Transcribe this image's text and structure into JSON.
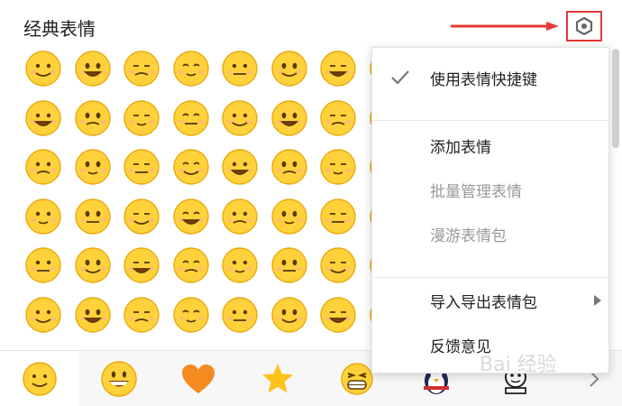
{
  "panel": {
    "title": "经典表情"
  },
  "settings": {
    "icon": "gear-icon",
    "highlight_color": "#e53935"
  },
  "menu": {
    "items": [
      {
        "label": "使用表情快捷键",
        "checked": true,
        "enabled": true,
        "submenu": false
      },
      {
        "label": "添加表情",
        "checked": false,
        "enabled": true,
        "submenu": false
      },
      {
        "label": "批量管理表情",
        "checked": false,
        "enabled": false,
        "submenu": false
      },
      {
        "label": "漫游表情包",
        "checked": false,
        "enabled": false,
        "submenu": false
      },
      {
        "label": "导入导出表情包",
        "checked": false,
        "enabled": true,
        "submenu": true
      },
      {
        "label": "反馈意见",
        "checked": false,
        "enabled": true,
        "submenu": false
      }
    ]
  },
  "emoji_grid": {
    "rows": 6,
    "columns": 9
  },
  "packs": {
    "tabs": [
      "classic-smiley-icon",
      "grin-icon",
      "heart-icon",
      "star-icon",
      "big-laugh-icon",
      "penguin-icon",
      "cartoon-face-icon"
    ],
    "active_index": 0
  },
  "watermark": {
    "text": "Bai 经验"
  },
  "colors": {
    "accent_red": "#e53935",
    "emoji_yellow": "#ffd23c",
    "heart": "#f68b1f",
    "star": "#ffc21a"
  }
}
